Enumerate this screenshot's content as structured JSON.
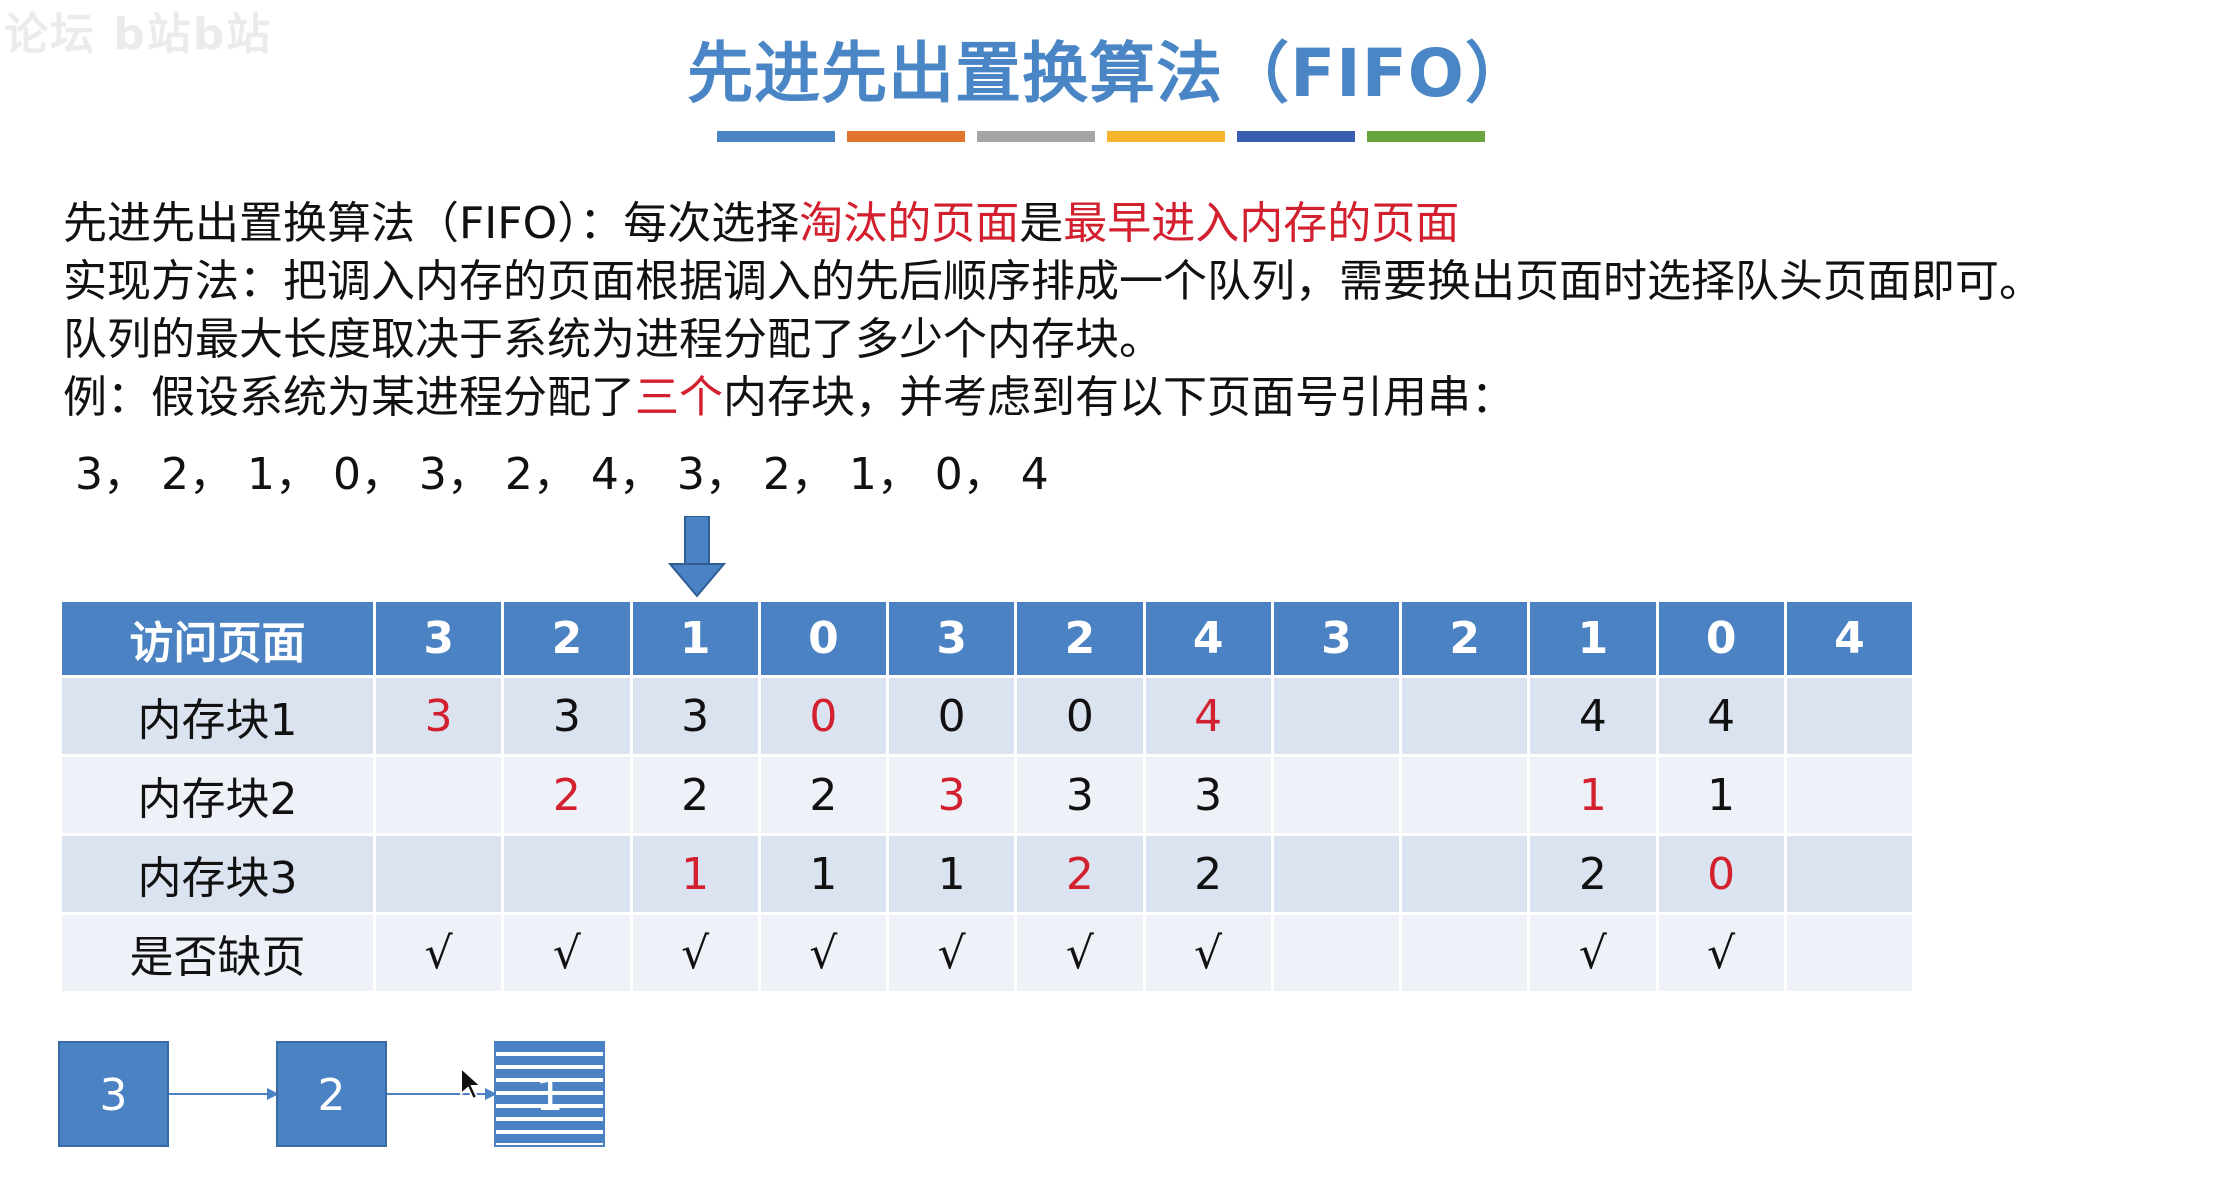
{
  "watermark": "论坛 b站b站",
  "title": "先进先出置换算法（FIFO）",
  "colors": {
    "title": "#4a86c5",
    "accent_red": "#d2202e",
    "table_header": "#4b82c3",
    "row_dark": "#dbe3f0",
    "row_light": "#eef2f8",
    "title_underline": [
      "#4a86c5",
      "#e0762e",
      "#a5a5a5",
      "#f5b52d",
      "#3b5fb0",
      "#6aa43e"
    ]
  },
  "definition": {
    "prefix": "先进先出置换算法（FIFO）：每次选择",
    "red1": "淘汰的页面",
    "mid": "是",
    "red2": "最早进入内存的页面"
  },
  "method": "实现方法：把调入内存的页面根据调入的先后顺序排成一个队列，需要换出页面时选择队头页面即可。",
  "queue_length": "队列的最大长度取决于系统为进程分配了多少个内存块。",
  "example": {
    "prefix": "例：假设系统为某进程分配了",
    "red": "三个",
    "suffix": "内存块，并考虑到有以下页面号引用串："
  },
  "reference_string": "3， 2， 1， 0， 3， 2， 4， 3， 2， 1， 0， 4",
  "pointer": {
    "icon": "down-arrow-icon",
    "current_column_index": 2
  },
  "table": {
    "header_label": "访问页面",
    "pages": [
      "3",
      "2",
      "1",
      "0",
      "3",
      "2",
      "4",
      "3",
      "2",
      "1",
      "0",
      "4"
    ],
    "rows": [
      {
        "label": "内存块1",
        "cells": [
          {
            "v": "3",
            "red": true
          },
          {
            "v": "3"
          },
          {
            "v": "3"
          },
          {
            "v": "0",
            "red": true
          },
          {
            "v": "0"
          },
          {
            "v": "0"
          },
          {
            "v": "4",
            "red": true
          },
          {
            "v": ""
          },
          {
            "v": ""
          },
          {
            "v": "4"
          },
          {
            "v": "4"
          },
          {
            "v": ""
          }
        ]
      },
      {
        "label": "内存块2",
        "cells": [
          {
            "v": ""
          },
          {
            "v": "2",
            "red": true
          },
          {
            "v": "2"
          },
          {
            "v": "2"
          },
          {
            "v": "3",
            "red": true
          },
          {
            "v": "3"
          },
          {
            "v": "3"
          },
          {
            "v": ""
          },
          {
            "v": ""
          },
          {
            "v": "1",
            "red": true
          },
          {
            "v": "1"
          },
          {
            "v": ""
          }
        ]
      },
      {
        "label": "内存块3",
        "cells": [
          {
            "v": ""
          },
          {
            "v": ""
          },
          {
            "v": "1",
            "red": true
          },
          {
            "v": "1"
          },
          {
            "v": "1"
          },
          {
            "v": "2",
            "red": true
          },
          {
            "v": "2"
          },
          {
            "v": ""
          },
          {
            "v": ""
          },
          {
            "v": "2"
          },
          {
            "v": "0",
            "red": true
          },
          {
            "v": ""
          }
        ]
      },
      {
        "label": "是否缺页",
        "cells": [
          {
            "v": "√"
          },
          {
            "v": "√"
          },
          {
            "v": "√"
          },
          {
            "v": "√"
          },
          {
            "v": "√"
          },
          {
            "v": "√"
          },
          {
            "v": "√"
          },
          {
            "v": ""
          },
          {
            "v": ""
          },
          {
            "v": "√"
          },
          {
            "v": "√"
          },
          {
            "v": ""
          }
        ]
      }
    ]
  },
  "queue": {
    "nodes": [
      {
        "value": "3"
      },
      {
        "value": "2"
      },
      {
        "value": "1",
        "animating": true
      }
    ]
  },
  "cursor": {
    "icon": "mouse-cursor-icon"
  }
}
